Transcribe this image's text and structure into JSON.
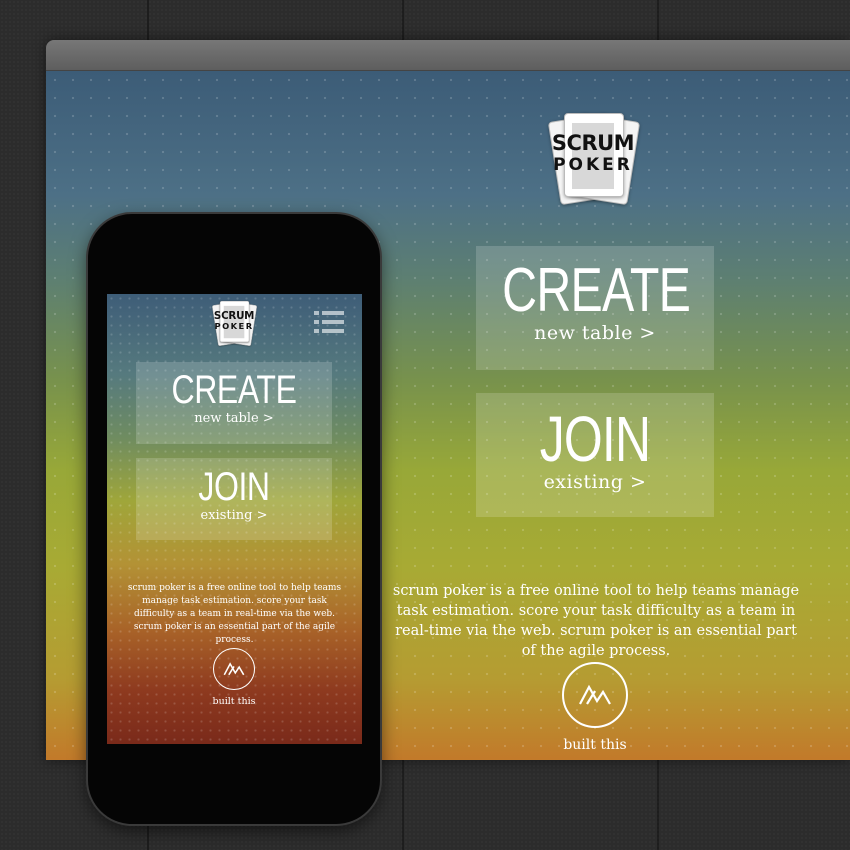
{
  "logo": {
    "line1": "SCRUM",
    "line2": "POKER"
  },
  "create": {
    "title": "CREATE",
    "subtitle": "new table  >"
  },
  "join": {
    "title": "JOIN",
    "subtitle": "existing  >"
  },
  "description": "scrum poker is a free online tool to help teams manage task estimation. score your task difficulty as a team in real-time via the web. scrum poker is an essential part of the agile process.",
  "built_this": "built this",
  "icons": {
    "logo": "playing-cards-logo",
    "menu": "hamburger-menu-icon",
    "built": "mountain-circle-icon"
  },
  "colors": {
    "gradient_top": "#3c5c77",
    "gradient_mid": "#98a838",
    "gradient_bottom_desktop": "#c2792a",
    "gradient_bottom_mobile": "#7a2a1a",
    "button_overlay": "rgba(255,255,255,0.17)",
    "text": "#ffffff"
  }
}
